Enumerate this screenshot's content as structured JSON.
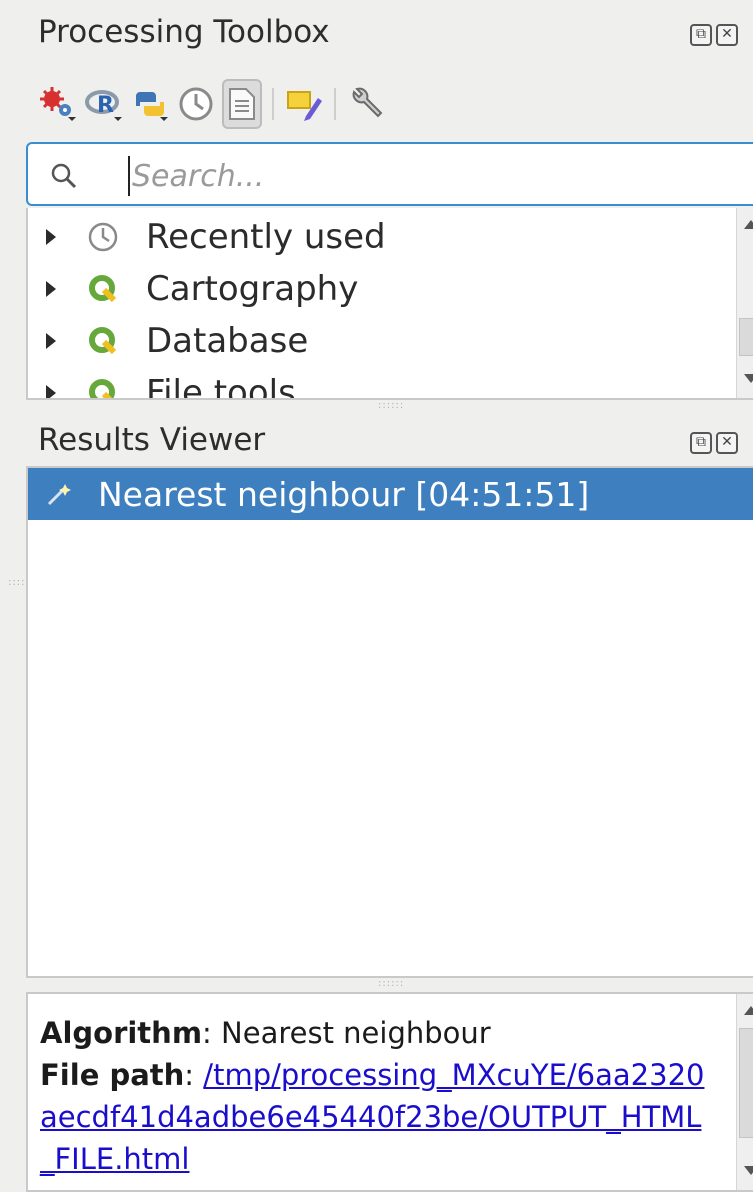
{
  "toolbox": {
    "title": "Processing Toolbox",
    "toolbar": [
      {
        "icon": "models-gear-icon"
      },
      {
        "icon": "r-script-icon"
      },
      {
        "icon": "python-script-icon"
      },
      {
        "icon": "history-clock-icon"
      },
      {
        "icon": "results-viewer-icon",
        "pressed": true
      },
      {
        "icon": "edit-features-in-place-icon"
      },
      {
        "icon": "options-wrench-icon"
      }
    ],
    "search_placeholder": "Search...",
    "tree": [
      {
        "label": "Recently used",
        "icon": "clock-icon"
      },
      {
        "label": "Cartography",
        "icon": "qgis-icon"
      },
      {
        "label": "Database",
        "icon": "qgis-icon"
      },
      {
        "label": "File tools",
        "icon": "qgis-icon"
      }
    ]
  },
  "results_viewer": {
    "title": "Results Viewer",
    "items": [
      {
        "label": "Nearest neighbour [04:51:51]",
        "selected": true,
        "icon": "algorithm-wand-icon"
      }
    ]
  },
  "details": {
    "algorithm_label": "Algorithm",
    "algorithm_value": ": Nearest neighbour",
    "file_path_label": "File path",
    "file_path_sep": ": ",
    "file_path_value": "/tmp/processing_MXcuYE/6aa2320aecdf41d4adbe6e45440f23be/OUTPUT_HTML_FILE.html"
  },
  "colors": {
    "selection": "#3d7fbf",
    "focus_border": "#3b8cd0",
    "link": "#1a0dcc",
    "qgis_green": "#66a83a"
  }
}
